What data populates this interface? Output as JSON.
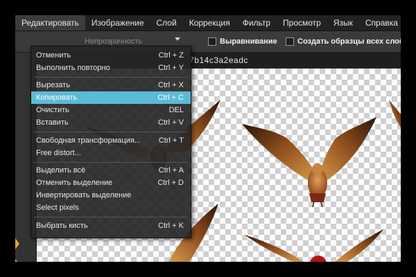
{
  "menubar": {
    "items": [
      "Редактировать",
      "Изображение",
      "Слой",
      "Коррекция",
      "Фильтр",
      "Просмотр",
      "Язык",
      "Справка"
    ],
    "active_index": 0
  },
  "toolbar": {
    "dimmed_label": "Непрозрачность",
    "align_label": "Выравнивание",
    "sample_label": "Создать образцы всех слоёв"
  },
  "document": {
    "title": "7b14c3a2eadc"
  },
  "edit_menu": {
    "groups": [
      [
        {
          "label": "Отменить",
          "shortcut": "Ctrl + Z"
        },
        {
          "label": "Выполнить повторно",
          "shortcut": "Ctrl + Y"
        }
      ],
      [
        {
          "label": "Вырезать",
          "shortcut": "Ctrl + X"
        },
        {
          "label": "Копировать",
          "shortcut": "Ctrl + C",
          "selected": true
        },
        {
          "label": "Очистить",
          "shortcut": "DEL"
        },
        {
          "label": "Вставить",
          "shortcut": "Ctrl + V"
        }
      ],
      [
        {
          "label": "Свободная трансформация...",
          "shortcut": "Ctrl + T"
        },
        {
          "label": "Free distort...",
          "shortcut": ""
        }
      ],
      [
        {
          "label": "Выделить всё",
          "shortcut": "Ctrl + A"
        },
        {
          "label": "Отменить выделение",
          "shortcut": "Ctrl + D"
        },
        {
          "label": "Инвертировать выделение",
          "shortcut": ""
        },
        {
          "label": "Select pixels",
          "shortcut": ""
        }
      ],
      [
        {
          "label": "Выбрать кисть",
          "shortcut": "Ctrl + K"
        }
      ]
    ]
  },
  "colors": {
    "selection": "#5bbbd6",
    "accent_tool": "#e8a13a"
  }
}
